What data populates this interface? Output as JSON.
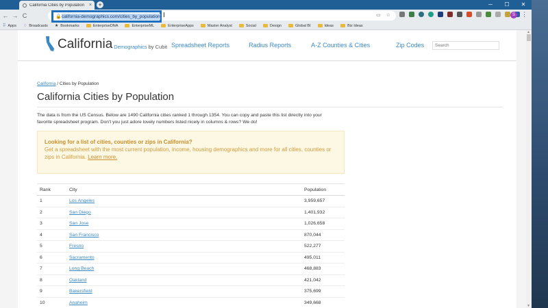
{
  "browser": {
    "tab_title": "California Cities by Population",
    "tab_close": "×",
    "new_tab": "+",
    "window_buttons": [
      "─",
      "☐",
      "✕"
    ],
    "nav_back": "←",
    "nav_forward": "→",
    "nav_reload": "C",
    "url": "california-demographics.com/cities_by_population",
    "profile_initial": "S",
    "bookmarks": [
      {
        "label": "Apps",
        "icon": "apps-grid-icon"
      },
      {
        "label": "Broadcasts",
        "icon": "dropper-icon"
      },
      {
        "label": "Bookmarks",
        "icon": "star-icon"
      },
      {
        "label": "EnterpriseDNA",
        "icon": "folder-icon"
      },
      {
        "label": "EnterpriseML",
        "icon": "folder-icon"
      },
      {
        "label": "EnterpriseApps",
        "icon": "folder-icon"
      },
      {
        "label": "Master Analyst",
        "icon": "folder-icon"
      },
      {
        "label": "Social",
        "icon": "folder-icon"
      },
      {
        "label": "Design",
        "icon": "folder-icon"
      },
      {
        "label": "Global BI",
        "icon": "folder-icon"
      },
      {
        "label": "Ideas",
        "icon": "folder-icon"
      },
      {
        "label": "Biz Ideas",
        "icon": "folder-icon"
      }
    ],
    "colors": {
      "accent": "#1f6fc1",
      "tabstrip": "#1f5f95",
      "profile": "#a23fc2"
    }
  },
  "site": {
    "logo_name": "California",
    "logo_sub": "Demographics",
    "logo_by": "by Cubit",
    "nav": [
      "Spreadsheet Reports",
      "Radius Reports",
      "A-Z Counties & Cities",
      "Zip Codes"
    ],
    "search_placeholder": "Search",
    "link_color": "#3b89c4"
  },
  "page": {
    "breadcrumb_link": "California",
    "breadcrumb_rest": " / Cities by Population",
    "title": "California Cities by Population",
    "intro": "The data is from the US Census. Below are 1490 California cities ranked 1 through 1354. You can copy and paste this list directly into your favorite spreadsheet program. Don't you just adore lovely numbers listed nicely in columns & rows? We do!",
    "callout_title": "Looking for a list of cities, counties or zips in California?",
    "callout_body": "Get a spreadsheet with the most current population, income, housing demographics and more for all cities, counties or zips in California. ",
    "callout_link": "Learn more.",
    "table": {
      "headers": [
        "Rank",
        "City",
        "Population"
      ],
      "rows": [
        [
          "1",
          "Los Angeles",
          "3,959,657"
        ],
        [
          "2",
          "San Diego",
          "1,401,932"
        ],
        [
          "3",
          "San Jose",
          "1,026,658"
        ],
        [
          "4",
          "San Francisco",
          "870,044"
        ],
        [
          "5",
          "Fresno",
          "522,277"
        ],
        [
          "6",
          "Sacramento",
          "495,011"
        ],
        [
          "7",
          "Long Beach",
          "468,883"
        ],
        [
          "8",
          "Oakland",
          "421,042"
        ],
        [
          "9",
          "Bakersfield",
          "375,699"
        ],
        [
          "10",
          "Anaheim",
          "349,668"
        ]
      ]
    }
  }
}
